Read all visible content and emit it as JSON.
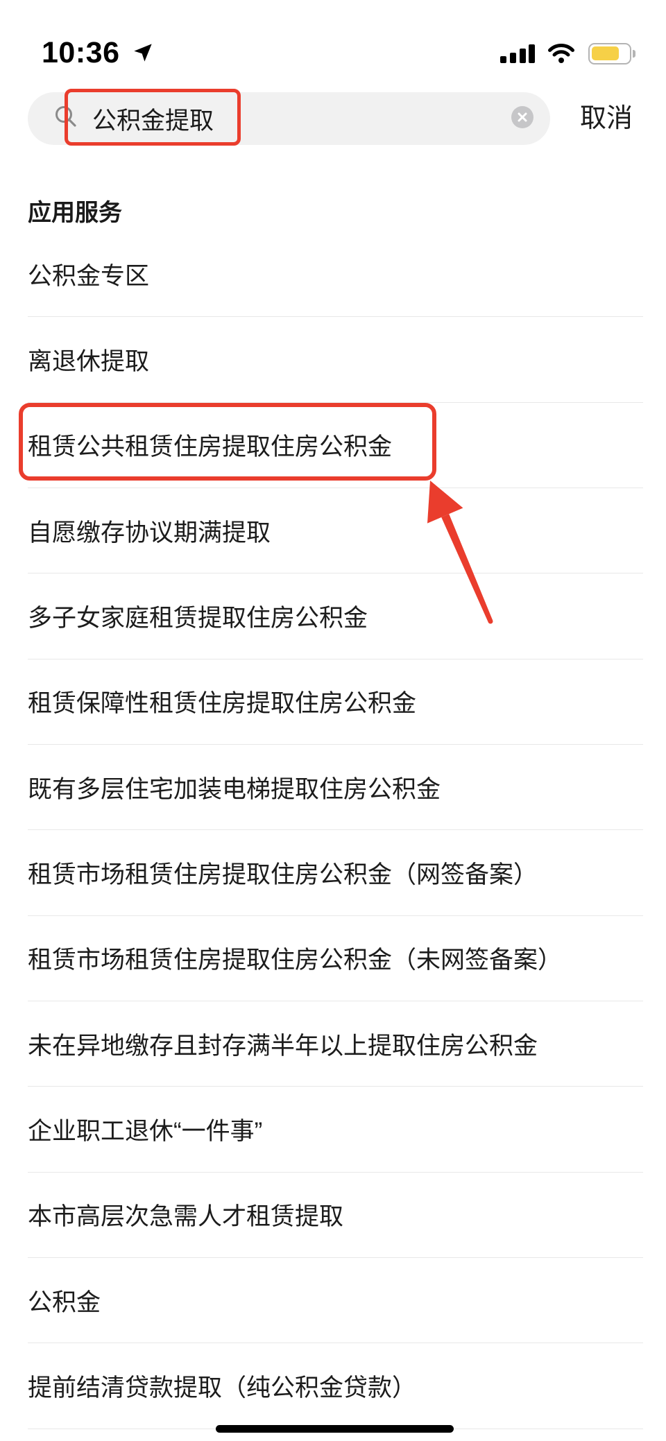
{
  "status_bar": {
    "time": "10:36",
    "battery_level": 0.7,
    "icons": [
      "location-arrow-icon",
      "cellular-signal-icon",
      "wifi-icon",
      "battery-icon"
    ]
  },
  "search": {
    "value": "公积金提取",
    "search_icon": "search-icon",
    "clear_icon": "clear-icon",
    "cancel_label": "取消"
  },
  "section": {
    "title": "应用服务",
    "items": [
      {
        "label": "公积金专区"
      },
      {
        "label": "离退休提取"
      },
      {
        "label": "租赁公共租赁住房提取住房公积金"
      },
      {
        "label": "自愿缴存协议期满提取"
      },
      {
        "label": "多子女家庭租赁提取住房公积金"
      },
      {
        "label": "租赁保障性租赁住房提取住房公积金"
      },
      {
        "label": "既有多层住宅加装电梯提取住房公积金"
      },
      {
        "label": "租赁市场租赁住房提取住房公积金（网签备案）"
      },
      {
        "label": "租赁市场租赁住房提取住房公积金（未网签备案）"
      },
      {
        "label": "未在异地缴存且封存满半年以上提取住房公积金"
      },
      {
        "label": "企业职工退休“一件事”"
      },
      {
        "label": "本市高层次急需人才租赁提取"
      },
      {
        "label": "公积金"
      },
      {
        "label": "提前结清贷款提取（纯公积金贷款）"
      }
    ]
  },
  "annotations": {
    "highlighted_item_index": 2
  },
  "colors": {
    "annotation": "#ea3d2d",
    "battery_fill": "#f6d047",
    "search_background": "#f1f1f1",
    "divider": "#e8e8e8"
  }
}
